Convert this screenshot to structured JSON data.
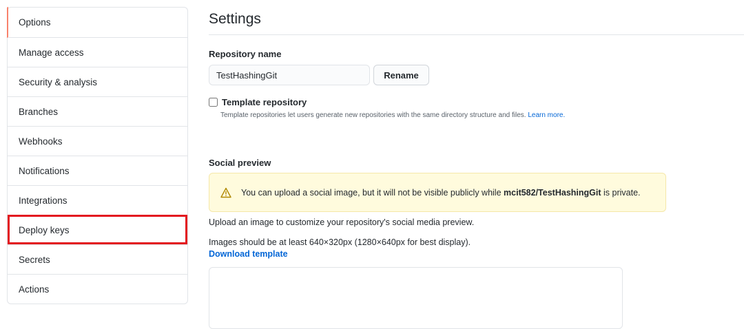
{
  "sidebar": {
    "items": [
      {
        "label": "Options"
      },
      {
        "label": "Manage access"
      },
      {
        "label": "Security & analysis"
      },
      {
        "label": "Branches"
      },
      {
        "label": "Webhooks"
      },
      {
        "label": "Notifications"
      },
      {
        "label": "Integrations"
      },
      {
        "label": "Deploy keys"
      },
      {
        "label": "Secrets"
      },
      {
        "label": "Actions"
      }
    ]
  },
  "main": {
    "title": "Settings",
    "repo_name_label": "Repository name",
    "repo_name_value": "TestHashingGit",
    "rename_label": "Rename",
    "template": {
      "label": "Template repository",
      "help": "Template repositories let users generate new repositories with the same directory structure and files.",
      "learn_more": "Learn more."
    },
    "social": {
      "heading": "Social preview",
      "warning_prefix": "You can upload a social image, but it will not be visible publicly while",
      "warning_repo": "mcit582/TestHashingGit",
      "warning_suffix": "is private.",
      "upload_text": "Upload an image to customize your repository's social media preview.",
      "size_text": "Images should be at least 640×320px (1280×640px for best display).",
      "download_link": "Download template"
    }
  },
  "colors": {
    "accent_link": "#0366d6",
    "highlight_box": "#e3171f",
    "warning_bg": "#fffbdd",
    "selected_marker": "#f9826c"
  }
}
